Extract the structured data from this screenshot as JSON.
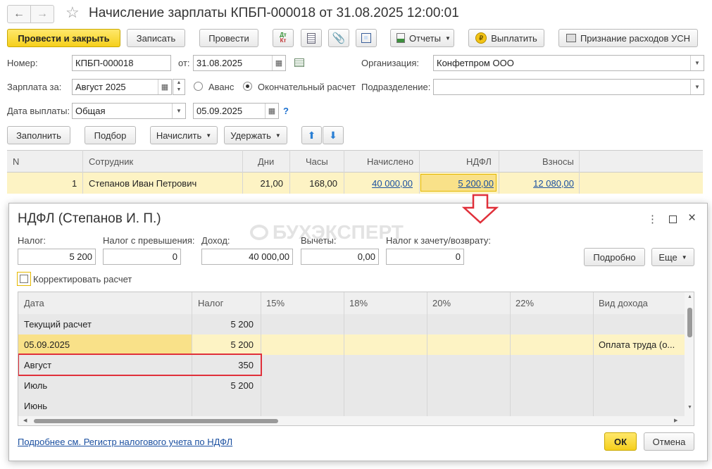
{
  "window": {
    "title": "Начисление зарплаты КПБП-000018 от 31.08.2025 12:00:01"
  },
  "toolbar": {
    "post_close": "Провести и закрыть",
    "save": "Записать",
    "post": "Провести",
    "dtkt_top": "Дт",
    "dtkt_bottom": "Кт",
    "reports": "Отчеты",
    "pay": "Выплатить",
    "usn": "Признание расходов УСН"
  },
  "form": {
    "number_label": "Номер:",
    "number_value": "КПБП-000018",
    "from_label": "от:",
    "date_value": "31.08.2025",
    "org_label": "Организация:",
    "org_value": "Конфетпром ООО",
    "salary_for_label": "Зарплата за:",
    "salary_for_value": "Август 2025",
    "advance_label": "Аванс",
    "final_label": "Окончательный расчет",
    "dept_label": "Подразделение:",
    "dept_value": "",
    "pay_date_label": "Дата выплаты:",
    "pay_type_value": "Общая",
    "pay_date_value": "05.09.2025",
    "help": "?"
  },
  "actions": {
    "fill": "Заполнить",
    "select": "Подбор",
    "accrue": "Начислить",
    "withhold": "Удержать"
  },
  "main_table": {
    "headers": {
      "n": "N",
      "employee": "Сотрудник",
      "days": "Дни",
      "hours": "Часы",
      "accrued": "Начислено",
      "ndfl": "НДФЛ",
      "contrib": "Взносы"
    },
    "row": {
      "n": "1",
      "employee": "Степанов Иван Петрович",
      "days": "21,00",
      "hours": "168,00",
      "accrued": "40 000,00",
      "ndfl": "5 200,00",
      "contrib": "12 080,00"
    }
  },
  "watermark": "БУХЭКСПЕРТ",
  "dialog": {
    "title": "НДФЛ (Степанов И. П.)",
    "menu": "⋮",
    "fields": {
      "tax_label": "Налог:",
      "tax_value": "5 200",
      "excess_label": "Налог с превышения:",
      "excess_value": "0",
      "income_label": "Доход:",
      "income_value": "40 000,00",
      "deductions_label": "Вычеты:",
      "deductions_value": "0,00",
      "offset_label": "Налог к зачету/возврату:",
      "offset_value": "0"
    },
    "details_button": "Подробно",
    "more_button": "Еще",
    "correct_label": "Корректировать расчет",
    "table": {
      "headers": {
        "date": "Дата",
        "tax": "Налог",
        "p15": "15%",
        "p18": "18%",
        "p20": "20%",
        "p22": "22%",
        "income_type": "Вид дохода"
      },
      "rows": [
        {
          "date": "Текущий расчет",
          "tax": "5 200",
          "income_type": ""
        },
        {
          "date": "05.09.2025",
          "tax": "5 200",
          "income_type": "Оплата труда (о..."
        },
        {
          "date": "Август",
          "tax": "350",
          "income_type": ""
        },
        {
          "date": "Июль",
          "tax": "5 200",
          "income_type": ""
        },
        {
          "date": "Июнь",
          "tax": "",
          "income_type": ""
        }
      ]
    },
    "link": "Подробнее см. Регистр налогового учета по НДФЛ",
    "ok": "ОК",
    "cancel": "Отмена"
  },
  "colors": {
    "accent_yellow": "#f5cf1c",
    "highlight_row": "#fdf3c4",
    "red_mark": "#e0303a",
    "link": "#1a4fa0"
  }
}
